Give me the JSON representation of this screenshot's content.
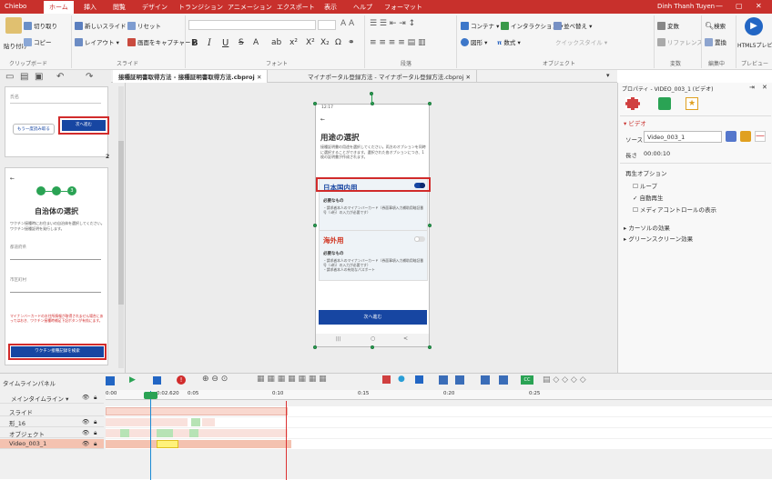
{
  "app": {
    "name": "Chiebo"
  },
  "menu_tabs": [
    "ホーム",
    "挿入",
    "閲覧",
    "デザイン",
    "トランジション",
    "アニメーション",
    "エクスポート",
    "表示",
    "ヘルプ",
    "フォーマット"
  ],
  "user_name": "Dinh Thanh Tuyen",
  "ribbon": {
    "paste_label": "貼り付け",
    "cut_label": "切り取り",
    "copy_label": "コピー",
    "new_slide_label": "新しいスライド",
    "reset_label": "リセット",
    "layout_label": "レイアウト",
    "screen_capture_label": "画面をキャプチャー",
    "content_label": "コンテナ",
    "interaction_label": "インタラクション",
    "arrange_label": "並べ替え",
    "shape_label": "図形",
    "math_label": "数式",
    "quick_style_label": "クイックスタイル",
    "find_label": "検索",
    "replace_label": "置換",
    "variable_label": "変数",
    "reference_label": "リファレンス",
    "html5_label": "HTML5プレビ",
    "groups": {
      "clipboard": "クリップボード",
      "slide": "スライド",
      "font": "フォント",
      "paragraph": "段落",
      "object": "オブジェクト",
      "variable": "変数",
      "edit": "編集中",
      "preview": "プレビュー"
    }
  },
  "doc_tabs": [
    "接種証明書取得方法 - 接種証明書取得方法.cbproj",
    "マイナポータル登録方法 - マイナポータル登録方法.cbproj"
  ],
  "slide_thumb_1": {
    "label": "氏名",
    "back_button": "もう一度読み取る",
    "next_button": "次へ進む"
  },
  "slide_thumb_2": {
    "number": "2",
    "title": "自治体の選択",
    "desc": "ワクチン接種時にお住まいの自治体を選択してください。ワクチン接種証明を発行します。",
    "field1": "都道府県",
    "field2": "市区町村",
    "warning": "マイナンバーカードのお住所情報が取得されません場合にあってはおき、ワクチン接種時補足下記ボタンが有効にます。",
    "button": "ワクチン接種記録を検索"
  },
  "phone": {
    "status_time": "12:17",
    "back_arrow": "←",
    "title": "用途の選択",
    "desc": "接種証明書の用途を選択してください。両方のオプションを同時に選択することができます。選択された各オプションにつき、1枚の証明書が作成されます。",
    "option1": {
      "title": "日本国内用",
      "need": "必要なもの",
      "bullets": "・請求者本人のマイナンバーカード（券面事項入力補助用暗証番号（4桁）の入力が必要です）"
    },
    "option2": {
      "title": "海外用",
      "need": "必要なもの",
      "bullets": "・請求者本人のマイナンバーカード（券面事項入力補助用暗証番号（4桁）の入力が必要です）\n・請求者本人の有効なパスポート"
    },
    "next_button": "次へ進む",
    "nav": [
      "|||",
      "○",
      "<"
    ]
  },
  "properties": {
    "title": "プロパティ - VIDEO_003_1 (ビデオ)",
    "section": "ビデオ",
    "source_label": "ソース",
    "source_value": "Video_003_1",
    "length_label": "長さ",
    "length_value": "00:00:10",
    "playback_label": "再生オプション",
    "loop_label": "ループ",
    "loop_checked": false,
    "autoplay_label": "自動再生",
    "autoplay_checked": true,
    "media_controls_label": "メディアコントロールの表示",
    "media_controls_checked": false,
    "cursor_effect_label": "カーソルの効果",
    "greenscreen_label": "グリーンスクリーン効果"
  },
  "timeline": {
    "panel_label": "タイムラインパネル",
    "ticks": [
      "0:00",
      "0:02.620",
      "0:05",
      "0:10",
      "0:15",
      "0:20",
      "0:25"
    ],
    "playhead_time": "0:02.620",
    "tracks": [
      "メインタイムライン",
      "スライド",
      "形_16",
      "オブジェクト",
      "Video_003_1"
    ]
  },
  "colors": {
    "accent": "#c8302c",
    "blue": "#1746a2",
    "green": "#2aa354"
  }
}
